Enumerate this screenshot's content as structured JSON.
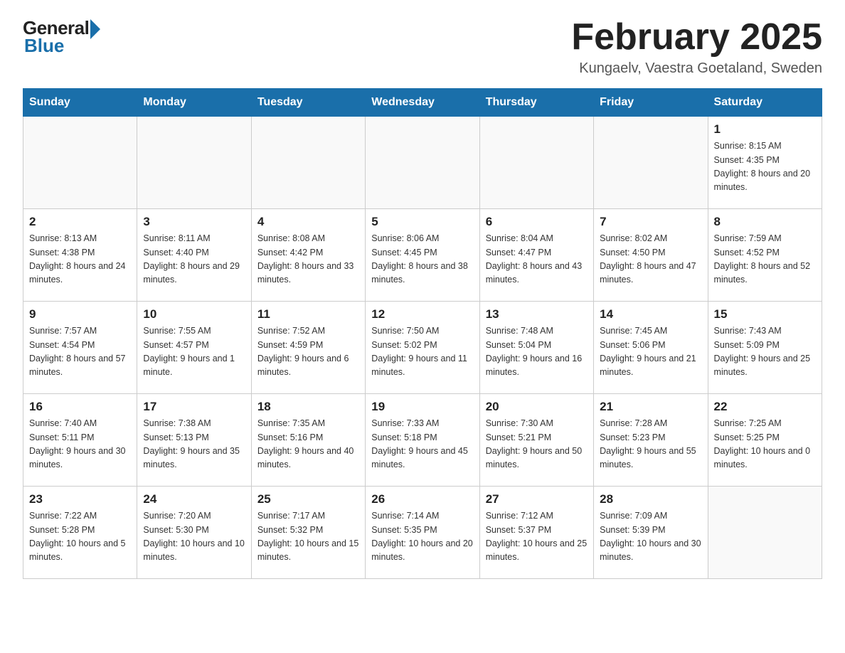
{
  "header": {
    "logo_general": "General",
    "logo_blue": "Blue",
    "title": "February 2025",
    "subtitle": "Kungaelv, Vaestra Goetaland, Sweden"
  },
  "days_of_week": [
    "Sunday",
    "Monday",
    "Tuesday",
    "Wednesday",
    "Thursday",
    "Friday",
    "Saturday"
  ],
  "weeks": [
    [
      {
        "day": "",
        "info": ""
      },
      {
        "day": "",
        "info": ""
      },
      {
        "day": "",
        "info": ""
      },
      {
        "day": "",
        "info": ""
      },
      {
        "day": "",
        "info": ""
      },
      {
        "day": "",
        "info": ""
      },
      {
        "day": "1",
        "info": "Sunrise: 8:15 AM\nSunset: 4:35 PM\nDaylight: 8 hours and 20 minutes."
      }
    ],
    [
      {
        "day": "2",
        "info": "Sunrise: 8:13 AM\nSunset: 4:38 PM\nDaylight: 8 hours and 24 minutes."
      },
      {
        "day": "3",
        "info": "Sunrise: 8:11 AM\nSunset: 4:40 PM\nDaylight: 8 hours and 29 minutes."
      },
      {
        "day": "4",
        "info": "Sunrise: 8:08 AM\nSunset: 4:42 PM\nDaylight: 8 hours and 33 minutes."
      },
      {
        "day": "5",
        "info": "Sunrise: 8:06 AM\nSunset: 4:45 PM\nDaylight: 8 hours and 38 minutes."
      },
      {
        "day": "6",
        "info": "Sunrise: 8:04 AM\nSunset: 4:47 PM\nDaylight: 8 hours and 43 minutes."
      },
      {
        "day": "7",
        "info": "Sunrise: 8:02 AM\nSunset: 4:50 PM\nDaylight: 8 hours and 47 minutes."
      },
      {
        "day": "8",
        "info": "Sunrise: 7:59 AM\nSunset: 4:52 PM\nDaylight: 8 hours and 52 minutes."
      }
    ],
    [
      {
        "day": "9",
        "info": "Sunrise: 7:57 AM\nSunset: 4:54 PM\nDaylight: 8 hours and 57 minutes."
      },
      {
        "day": "10",
        "info": "Sunrise: 7:55 AM\nSunset: 4:57 PM\nDaylight: 9 hours and 1 minute."
      },
      {
        "day": "11",
        "info": "Sunrise: 7:52 AM\nSunset: 4:59 PM\nDaylight: 9 hours and 6 minutes."
      },
      {
        "day": "12",
        "info": "Sunrise: 7:50 AM\nSunset: 5:02 PM\nDaylight: 9 hours and 11 minutes."
      },
      {
        "day": "13",
        "info": "Sunrise: 7:48 AM\nSunset: 5:04 PM\nDaylight: 9 hours and 16 minutes."
      },
      {
        "day": "14",
        "info": "Sunrise: 7:45 AM\nSunset: 5:06 PM\nDaylight: 9 hours and 21 minutes."
      },
      {
        "day": "15",
        "info": "Sunrise: 7:43 AM\nSunset: 5:09 PM\nDaylight: 9 hours and 25 minutes."
      }
    ],
    [
      {
        "day": "16",
        "info": "Sunrise: 7:40 AM\nSunset: 5:11 PM\nDaylight: 9 hours and 30 minutes."
      },
      {
        "day": "17",
        "info": "Sunrise: 7:38 AM\nSunset: 5:13 PM\nDaylight: 9 hours and 35 minutes."
      },
      {
        "day": "18",
        "info": "Sunrise: 7:35 AM\nSunset: 5:16 PM\nDaylight: 9 hours and 40 minutes."
      },
      {
        "day": "19",
        "info": "Sunrise: 7:33 AM\nSunset: 5:18 PM\nDaylight: 9 hours and 45 minutes."
      },
      {
        "day": "20",
        "info": "Sunrise: 7:30 AM\nSunset: 5:21 PM\nDaylight: 9 hours and 50 minutes."
      },
      {
        "day": "21",
        "info": "Sunrise: 7:28 AM\nSunset: 5:23 PM\nDaylight: 9 hours and 55 minutes."
      },
      {
        "day": "22",
        "info": "Sunrise: 7:25 AM\nSunset: 5:25 PM\nDaylight: 10 hours and 0 minutes."
      }
    ],
    [
      {
        "day": "23",
        "info": "Sunrise: 7:22 AM\nSunset: 5:28 PM\nDaylight: 10 hours and 5 minutes."
      },
      {
        "day": "24",
        "info": "Sunrise: 7:20 AM\nSunset: 5:30 PM\nDaylight: 10 hours and 10 minutes."
      },
      {
        "day": "25",
        "info": "Sunrise: 7:17 AM\nSunset: 5:32 PM\nDaylight: 10 hours and 15 minutes."
      },
      {
        "day": "26",
        "info": "Sunrise: 7:14 AM\nSunset: 5:35 PM\nDaylight: 10 hours and 20 minutes."
      },
      {
        "day": "27",
        "info": "Sunrise: 7:12 AM\nSunset: 5:37 PM\nDaylight: 10 hours and 25 minutes."
      },
      {
        "day": "28",
        "info": "Sunrise: 7:09 AM\nSunset: 5:39 PM\nDaylight: 10 hours and 30 minutes."
      },
      {
        "day": "",
        "info": ""
      }
    ]
  ]
}
